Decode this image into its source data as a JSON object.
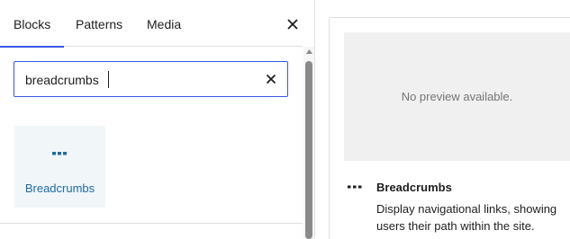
{
  "tabs": [
    {
      "label": "Blocks",
      "active": true
    },
    {
      "label": "Patterns",
      "active": false
    },
    {
      "label": "Media",
      "active": false
    }
  ],
  "search": {
    "value": "breadcrumbs"
  },
  "results": [
    {
      "label": "Breadcrumbs",
      "icon": "breadcrumbs-icon"
    }
  ],
  "preview": {
    "empty_text": "No preview available.",
    "title": "Breadcrumbs",
    "icon": "breadcrumbs-icon",
    "description": "Display navigational links, showing users their path within the site."
  },
  "colors": {
    "accent": "#3858e9",
    "block_label": "#1c6ba5"
  }
}
